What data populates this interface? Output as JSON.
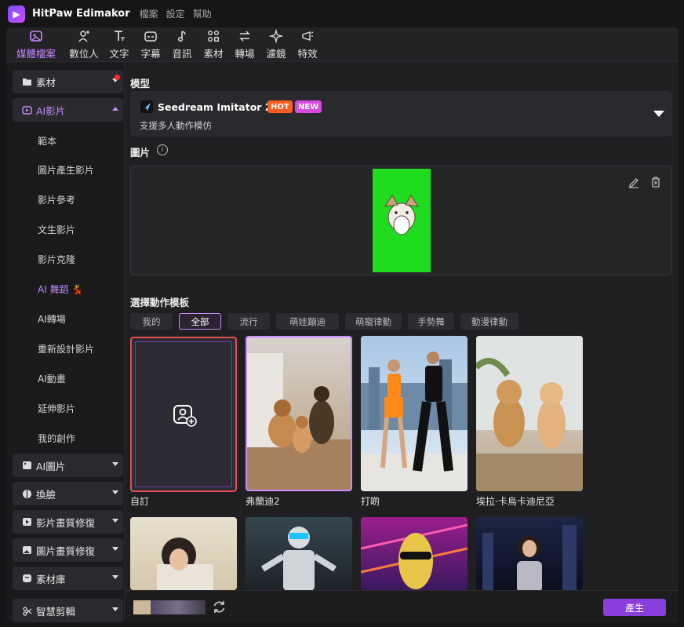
{
  "app": {
    "name": "HitPaw Edimakor",
    "menu": [
      "檔案",
      "設定",
      "幫助"
    ]
  },
  "toolbar": [
    {
      "label": "媒體檔案",
      "icon": "media-icon",
      "active": true
    },
    {
      "label": "數位人",
      "icon": "avatar-add-icon"
    },
    {
      "label": "文字",
      "icon": "text-icon"
    },
    {
      "label": "字幕",
      "icon": "caption-icon"
    },
    {
      "label": "音訊",
      "icon": "music-note-icon"
    },
    {
      "label": "素材",
      "icon": "assets-icon"
    },
    {
      "label": "轉場",
      "icon": "transition-icon"
    },
    {
      "label": "濾鏡",
      "icon": "sparkle-icon"
    },
    {
      "label": "特效",
      "icon": "effects-icon"
    }
  ],
  "sidebar": {
    "categories": [
      {
        "label": "素材",
        "icon": "folder-icon",
        "expanded": false,
        "notification": true
      },
      {
        "label": "AI影片",
        "icon": "ai-video-icon",
        "expanded": true
      },
      {
        "label": "AI圖片",
        "icon": "ai-image-icon"
      },
      {
        "label": "換臉",
        "icon": "face-swap-icon"
      },
      {
        "label": "影片畫質修復",
        "icon": "video-enhance-icon"
      },
      {
        "label": "圖片畫質修復",
        "icon": "image-enhance-icon"
      },
      {
        "label": "素材庫",
        "icon": "library-icon"
      },
      {
        "label": "智慧剪輯",
        "icon": "smart-edit-icon"
      }
    ],
    "sub_items": [
      "範本",
      "圖片產生影片",
      "影片參考",
      "文生影片",
      "影片克隆",
      "AI 舞蹈",
      "AI轉場",
      "重新設計影片",
      "AI動畫",
      "延伸影片",
      "我的創作"
    ],
    "active_sub": "AI 舞蹈",
    "active_sub_emoji": "💃"
  },
  "main": {
    "model_label": "模型",
    "model": {
      "name": "Seedream Imitator 2.0",
      "hot": "HOT",
      "new": "NEW",
      "desc": "支援多人動作模仿"
    },
    "image_label": "圖片",
    "template_label": "選擇動作模板",
    "tabs": [
      "我的",
      "全部",
      "流行",
      "萌娃蹦迪",
      "萌寵律動",
      "手勢舞",
      "動漫律動"
    ],
    "active_tab": "全部",
    "cards": [
      {
        "label": "自訂",
        "type": "custom"
      },
      {
        "label": "弗蘭迪2",
        "type": "dogs"
      },
      {
        "label": "打啲",
        "type": "dancers"
      },
      {
        "label": "埃拉·卡烏卡迪尼亞",
        "type": "cats"
      }
    ],
    "row2_cards": [
      "girl",
      "robot",
      "banana",
      "city-woman"
    ],
    "generate": "產生"
  },
  "colors": {
    "accent": "#c58bff",
    "button": "#8a3fdc",
    "green": "#1fdc1f",
    "hot": "#ff5a1f",
    "new": "#d84adf",
    "selected_border": "#e0504f"
  }
}
